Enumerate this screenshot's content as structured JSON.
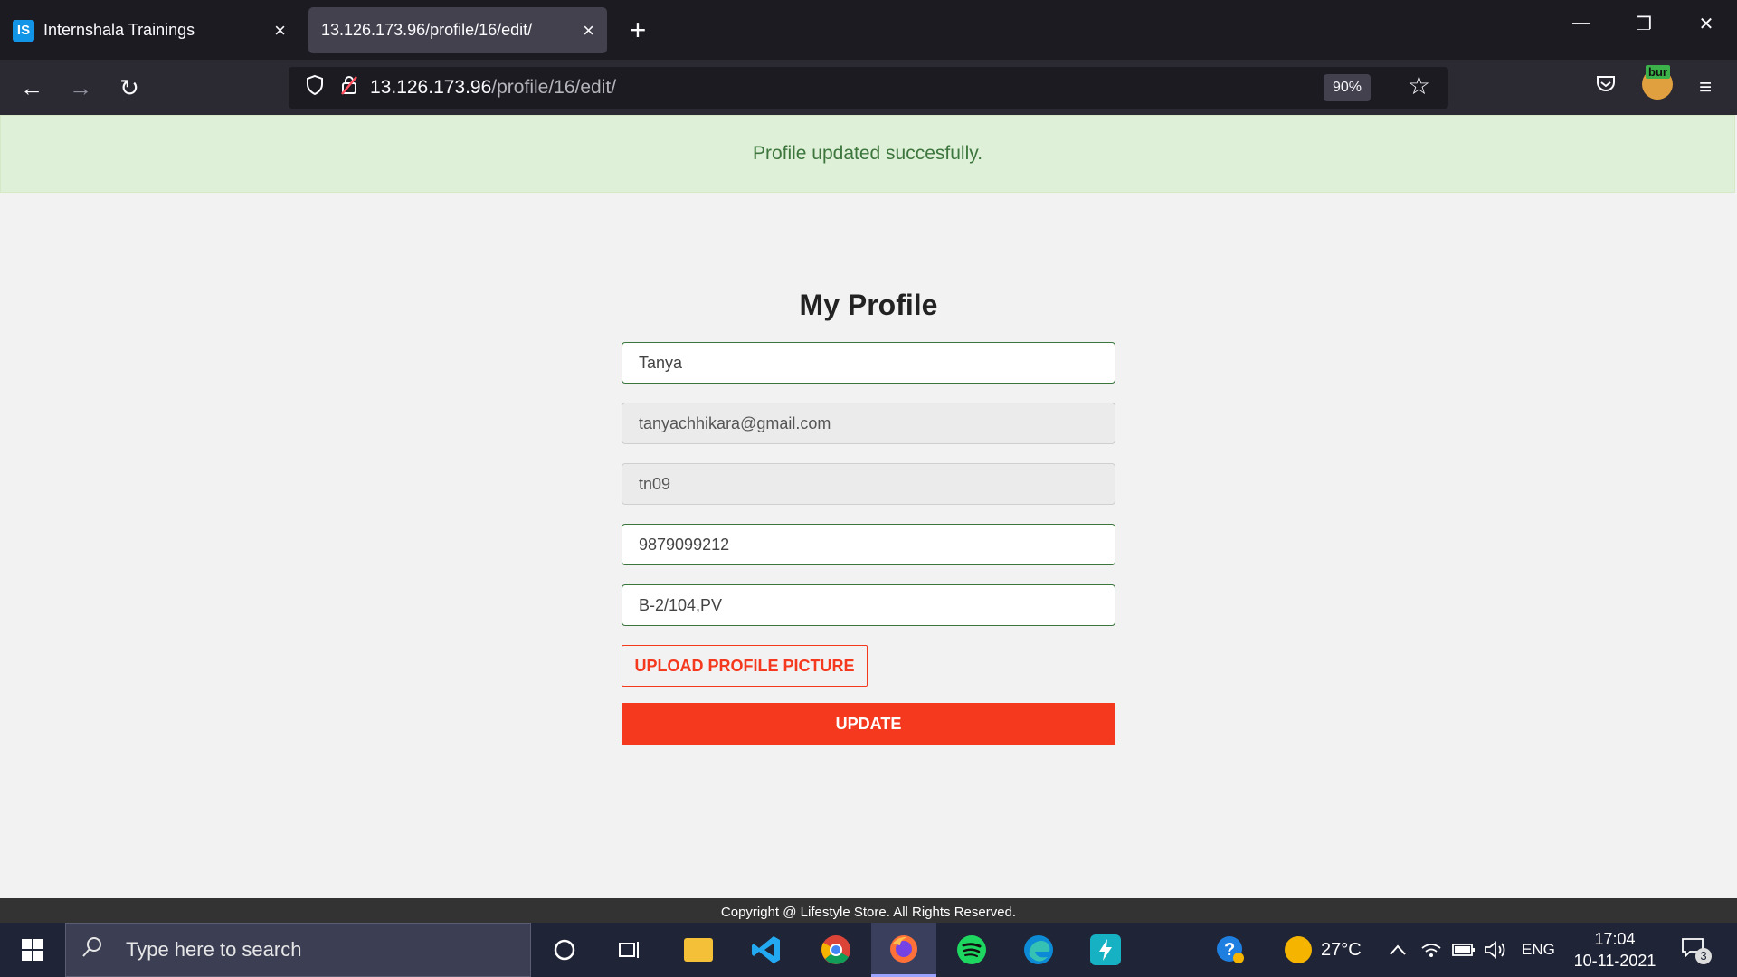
{
  "browser": {
    "tabs": [
      {
        "favicon": "IS",
        "title": "Internshala Trainings",
        "close": "×"
      },
      {
        "title": "13.126.173.96/profile/16/edit/",
        "close": "×"
      }
    ],
    "new_tab": "+",
    "window_controls": {
      "minimize": "—",
      "restore": "❐",
      "close": "✕"
    },
    "nav": {
      "back": "←",
      "forward": "→",
      "reload": "↻"
    },
    "url": {
      "host": "13.126.173.96",
      "path": "/profile/16/edit/"
    },
    "zoom": "90%",
    "bookmark_star": "☆",
    "pocket_icon": "pocket-icon",
    "extension_badge": "bur",
    "menu": "≡"
  },
  "alert": {
    "message": "Profile updated succesfully."
  },
  "profile": {
    "title": "My Profile",
    "name": "Tanya",
    "email": "tanyachhikara@gmail.com",
    "username": "tn09",
    "phone": "9879099212",
    "address": "B-2/104,PV",
    "upload_label": "UPLOAD PROFILE PICTURE",
    "update_label": "UPDATE"
  },
  "footer": {
    "text": "Copyright @ Lifestyle Store. All Rights Reserved."
  },
  "taskbar": {
    "search_placeholder": "Type here to search",
    "apps": [
      "cortana",
      "task-view",
      "file-explorer",
      "vs-code",
      "chrome",
      "firefox",
      "spotify",
      "edge",
      "bolt"
    ],
    "weather": "27°C",
    "language": "ENG",
    "time": "17:04",
    "date": "10-11-2021",
    "notification_count": "3"
  },
  "colors": {
    "accent": "#f4391f",
    "success_bg": "#dff0d8",
    "success_text": "#3c763d",
    "browser_bg": "#1c1b22"
  }
}
